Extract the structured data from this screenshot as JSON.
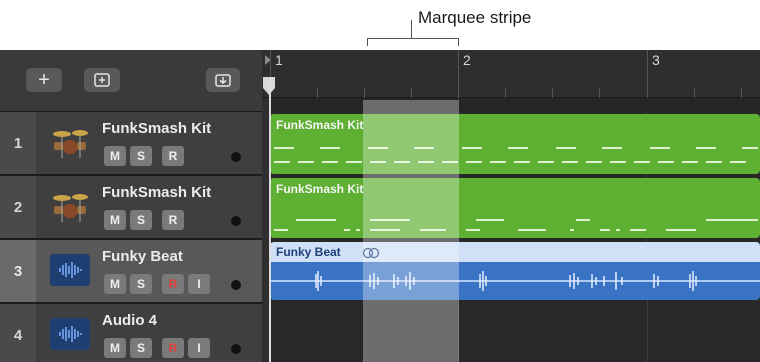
{
  "annotation": {
    "label": "Marquee stripe"
  },
  "toolbar": {
    "add_icon": "+",
    "new_folder_icon": "folder-plus",
    "download_icon": "arrow-down-tray"
  },
  "ruler": {
    "bars": [
      "1",
      "2",
      "3"
    ]
  },
  "tracks": [
    {
      "number": "1",
      "name": "FunkSmash Kit",
      "type": "drums",
      "mute": "M",
      "solo": "S",
      "record": "R",
      "input": ""
    },
    {
      "number": "2",
      "name": "FunkSmash Kit",
      "type": "drums",
      "mute": "M",
      "solo": "S",
      "record": "R",
      "input": ""
    },
    {
      "number": "3",
      "name": "Funky Beat",
      "type": "audio",
      "mute": "M",
      "solo": "S",
      "record": "R",
      "input": "I"
    },
    {
      "number": "4",
      "name": "Audio 4",
      "type": "audio",
      "mute": "M",
      "solo": "S",
      "record": "R",
      "input": "I"
    }
  ],
  "regions": [
    {
      "title": "FunkSmash Kit",
      "color": "#5db032"
    },
    {
      "title": "FunkSmash Kit",
      "color": "#5db032"
    },
    {
      "title": "Funky Beat",
      "color": "#3a73c4"
    }
  ],
  "colors": {
    "drummer_region": "#5db032",
    "audio_region": "#3a73c4",
    "record_armed": "#e0413a"
  }
}
